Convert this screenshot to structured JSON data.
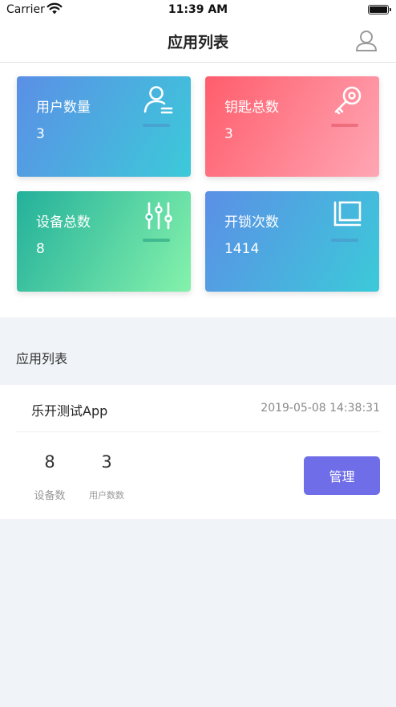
{
  "status_bar": {
    "carrier": "Carrier",
    "time": "11:39 AM",
    "icons": [
      "wifi-icon",
      "battery-icon"
    ]
  },
  "nav": {
    "title": "应用列表",
    "right_icon": "user-profile-icon"
  },
  "stats": [
    {
      "label": "用户数量",
      "value": "3",
      "icon": "user-icon",
      "colors": [
        "#5b8fe6",
        "#3ccad9"
      ]
    },
    {
      "label": "钥匙总数",
      "value": "3",
      "icon": "key-icon",
      "colors": [
        "#ff5d6c",
        "#ffa6b4"
      ]
    },
    {
      "label": "设备总数",
      "value": "8",
      "icon": "sliders-icon",
      "colors": [
        "#23b09b",
        "#85f2ab"
      ]
    },
    {
      "label": "开锁次数",
      "value": "1414",
      "icon": "monitor-icon",
      "colors": [
        "#5b8fe6",
        "#3ccad9"
      ]
    }
  ],
  "section": {
    "title": "应用列表"
  },
  "app": {
    "name": "乐开测试App",
    "date": "2019-05-08 14:38:31",
    "devices_value": "8",
    "devices_label": "设备数",
    "users_value": "3",
    "users_label": "用户数数",
    "manage_label": "管理"
  },
  "colors": {
    "accent": "#6f6ee8",
    "background": "#f0f3f7"
  }
}
